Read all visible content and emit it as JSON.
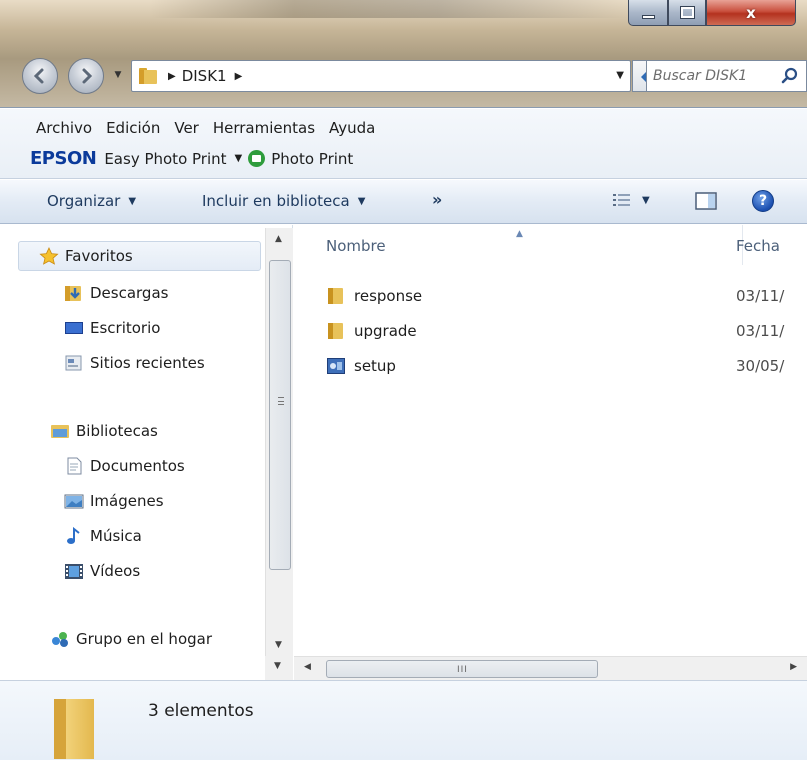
{
  "window": {
    "controls": {
      "close_glyph": "x"
    }
  },
  "address": {
    "crumbs": [
      "DISK1"
    ],
    "search_placeholder": "Buscar DISK1"
  },
  "menu": {
    "items": [
      "Archivo",
      "Edición",
      "Ver",
      "Herramientas",
      "Ayuda"
    ]
  },
  "epson": {
    "logo": "EPSON",
    "easy_photo_print": "Easy Photo Print",
    "photo_print": "Photo Print"
  },
  "toolbar": {
    "organize": "Organizar",
    "include_library": "Incluir en biblioteca",
    "more": "»"
  },
  "navpane": {
    "favorites": {
      "label": "Favoritos",
      "items": [
        "Descargas",
        "Escritorio",
        "Sitios recientes"
      ]
    },
    "libraries": {
      "label": "Bibliotecas",
      "items": [
        "Documentos",
        "Imágenes",
        "Música",
        "Vídeos"
      ]
    },
    "homegroup": "Grupo en el hogar"
  },
  "filelist": {
    "columns": {
      "name": "Nombre",
      "date": "Fecha"
    },
    "rows": [
      {
        "name": "response",
        "type": "folder",
        "date": "03/11/"
      },
      {
        "name": "upgrade",
        "type": "folder",
        "date": "03/11/"
      },
      {
        "name": "setup",
        "type": "setup",
        "date": "30/05/"
      }
    ]
  },
  "scrollbar": {
    "grip": "III"
  },
  "details": {
    "count": "3 elementos"
  },
  "colors": {
    "folder": "#e8c25a",
    "epson_blue": "#0b3a9b",
    "link_text": "#1e3a5f"
  }
}
